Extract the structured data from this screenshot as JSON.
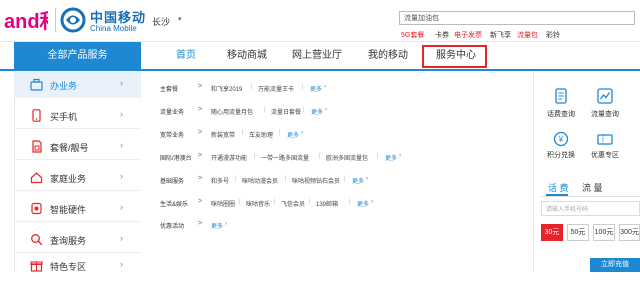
{
  "brand": {
    "and_logo_text": "and和",
    "name_cn": "中国移动",
    "name_en": "China Mobile"
  },
  "header": {
    "city": "长沙",
    "search_value": "流量加油包",
    "hot_words": [
      {
        "label": "5G套餐",
        "color": "#e6242a"
      },
      {
        "label": "卡券",
        "color": "#333333"
      },
      {
        "label": "电子发票",
        "color": "#e6242a"
      },
      {
        "label": "新飞享",
        "color": "#333333"
      },
      {
        "label": "流量包",
        "color": "#e6242a"
      },
      {
        "label": "彩铃",
        "color": "#333333"
      }
    ]
  },
  "nav": {
    "all_products": "全部产品服务",
    "items": [
      "首页",
      "移动商城",
      "网上营业厅",
      "我的移动",
      "服务中心"
    ],
    "active_index": 0,
    "highlighted_index": 4
  },
  "sidebar": {
    "items": [
      {
        "label": "办业务",
        "icon": "briefcase-icon",
        "active": true
      },
      {
        "label": "买手机",
        "icon": "phone-icon",
        "active": false
      },
      {
        "label": "套餐/靓号",
        "icon": "sim-card-icon",
        "active": false
      },
      {
        "label": "家庭业务",
        "icon": "home-icon",
        "active": false
      },
      {
        "label": "智能硬件",
        "icon": "smart-device-icon",
        "active": false
      },
      {
        "label": "查询服务",
        "icon": "search-icon",
        "active": false
      },
      {
        "label": "特色专区",
        "icon": "gift-icon",
        "active": false
      }
    ]
  },
  "menu": {
    "more_label": "更多",
    "rows": [
      {
        "category": "主套餐",
        "items": [
          "和飞享2019",
          "万能流量王卡"
        ]
      },
      {
        "category": "流量业务",
        "items": [
          "随心用流量月包",
          "流量日套餐"
        ]
      },
      {
        "category": "宽带业务",
        "items": [
          "新装宽带",
          "车友助理"
        ]
      },
      {
        "category": "国际/港澳台",
        "items": [
          "开通漫游功能",
          "一带一路多国流量",
          "欧洲多国流量包"
        ]
      },
      {
        "category": "基础服务",
        "items": [
          "和多号",
          "咪咕动漫会员",
          "咪咕视频钻石会员"
        ]
      },
      {
        "category": "生活&娱乐",
        "items": [
          "咪咕圈圈",
          "咪咕音乐",
          "飞信会员",
          "139邮箱"
        ]
      },
      {
        "category": "优惠活动",
        "items": []
      }
    ]
  },
  "right_panel": {
    "quick_links": [
      {
        "label": "话费查询",
        "icon": "bill-query-icon"
      },
      {
        "label": "流量查询",
        "icon": "data-query-icon"
      },
      {
        "label": "积分兑换",
        "icon": "points-icon"
      },
      {
        "label": "优惠专区",
        "icon": "coupon-icon"
      }
    ],
    "tabs": [
      "话 费",
      "流 量"
    ],
    "active_tab": 0,
    "phone_placeholder": "请输入手机号码",
    "amounts": [
      "30元",
      "50元",
      "100元",
      "300元"
    ],
    "selected_amount_index": 0,
    "recharge_label": "立即充值"
  },
  "colors": {
    "accent_blue": "#1e88d3",
    "accent_red": "#e6242a",
    "and_pink": "#e4007f",
    "brand_blue": "#1570b8"
  }
}
